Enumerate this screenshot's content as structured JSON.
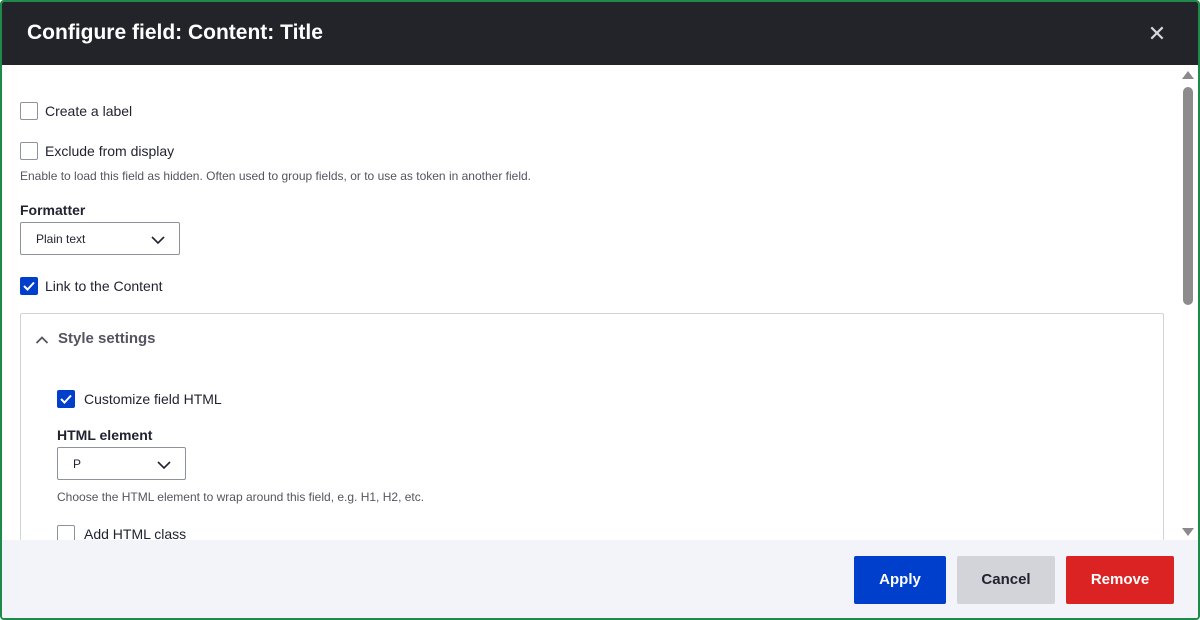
{
  "dialog": {
    "title": "Configure field: Content: Title",
    "close_icon": "close-icon"
  },
  "form": {
    "create_label": {
      "label": "Create a label",
      "checked": false
    },
    "exclude_display": {
      "label": "Exclude from display",
      "checked": false,
      "description": "Enable to load this field as hidden. Often used to group fields, or to use as token in another field."
    },
    "formatter": {
      "label": "Formatter",
      "value": "Plain text"
    },
    "link_content": {
      "label": "Link to the Content",
      "checked": true
    },
    "style_settings": {
      "summary": "Style settings",
      "expanded": true,
      "customize_html": {
        "label": "Customize field HTML",
        "checked": true
      },
      "html_element": {
        "label": "HTML element",
        "value": "P",
        "description": "Choose the HTML element to wrap around this field, e.g. H1, H2, etc."
      },
      "add_html_class": {
        "label": "Add HTML class",
        "checked": false
      }
    }
  },
  "footer": {
    "apply_label": "Apply",
    "cancel_label": "Cancel",
    "remove_label": "Remove"
  },
  "colors": {
    "titlebar": "#232429",
    "primary": "#003ecc",
    "danger": "#dc2323",
    "neutral_button": "#d3d4d9",
    "footer_bg": "#f3f4f9",
    "frame_border": "#1e8a4a"
  }
}
